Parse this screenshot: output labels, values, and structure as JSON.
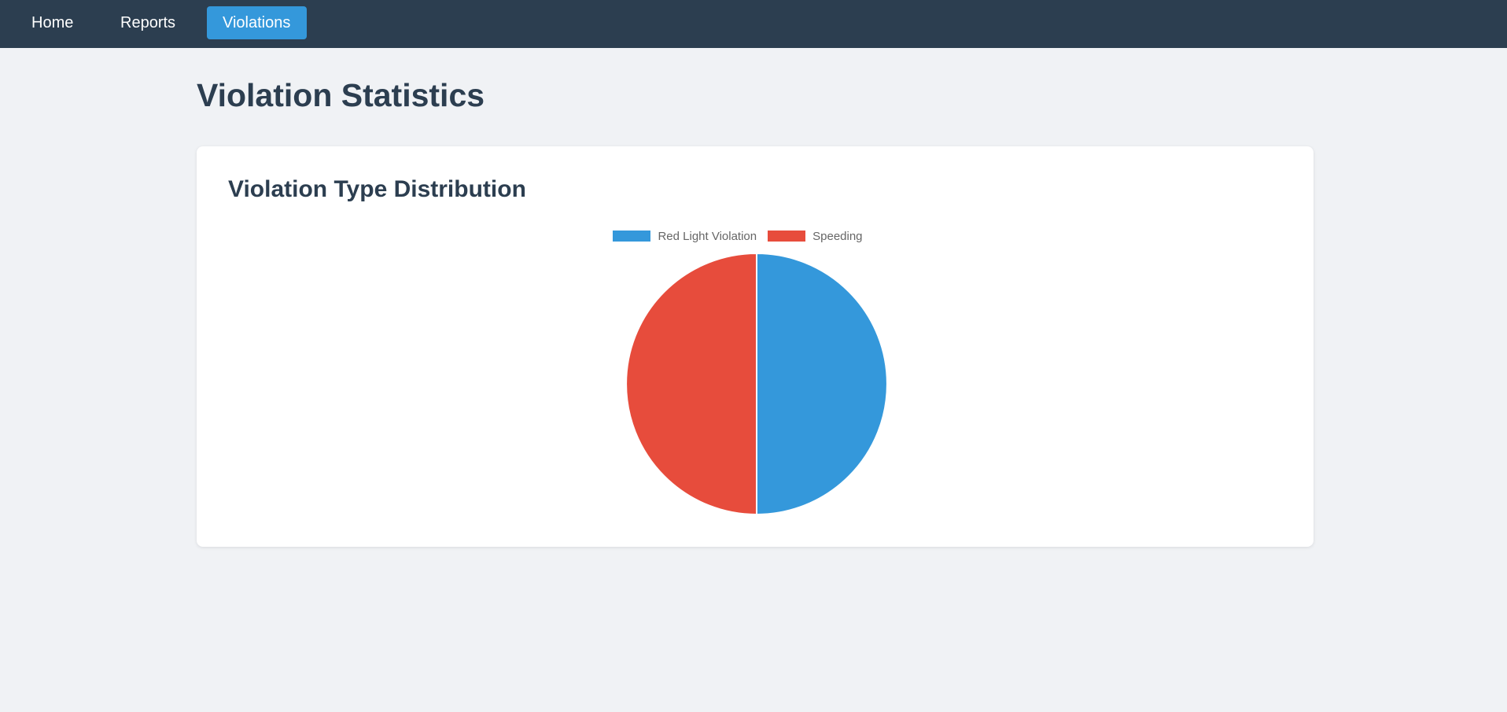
{
  "nav": {
    "items": [
      {
        "label": "Home"
      },
      {
        "label": "Reports"
      },
      {
        "label": "Violations",
        "active": true
      }
    ],
    "background": "#2c3e50",
    "active_color": "#3498db"
  },
  "page": {
    "title": "Violation Statistics"
  },
  "card": {
    "title": "Violation Type Distribution"
  },
  "chart_data": {
    "type": "pie",
    "categories": [
      "Red Light Violation",
      "Speeding"
    ],
    "values": [
      50,
      50
    ],
    "colors": [
      "#3498db",
      "#e74c3c"
    ],
    "legend_position": "top"
  }
}
